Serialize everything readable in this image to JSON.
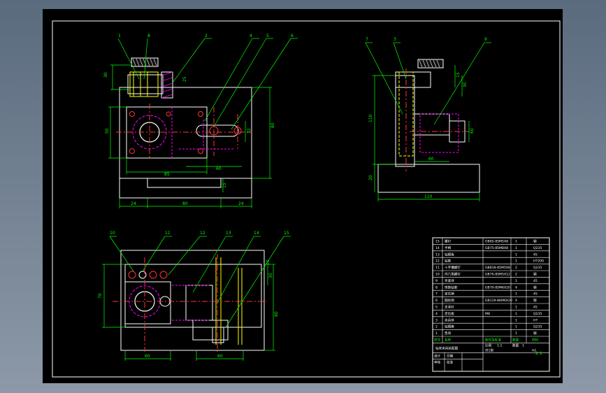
{
  "drawing": {
    "scale_note": "2:1",
    "front_view": {
      "balloons": [
        "1",
        "8",
        "2",
        "4",
        "5",
        "6"
      ],
      "dims": {
        "h_left_top": "30",
        "v_mid": "25",
        "left_height": "50",
        "hole_dia": "32",
        "right_height": "80",
        "width_85": "85",
        "width_60": "60",
        "bottom_24a": "24",
        "bottom_80": "80",
        "bottom_24b": "24",
        "step_15": "15"
      }
    },
    "side_view": {
      "balloons": [
        "7",
        "3",
        "9"
      ],
      "dims": {
        "height_110": "110",
        "base_20": "20",
        "top_15": "15",
        "side_30": "30",
        "pin_60": "60",
        "len_60": "60",
        "bottom_110": "110"
      }
    },
    "top_view": {
      "balloons": [
        "10",
        "11",
        "12",
        "13",
        "14",
        "15"
      ],
      "dims": {
        "height_70": "70",
        "bottom_60a": "60",
        "bottom_60b": "60",
        "right_80": "80",
        "right_30": "30",
        "right_20": "20"
      }
    },
    "bom": {
      "rows": [
        [
          "15",
          "螺钉",
          "GB65-85M5X8",
          "1",
          "钢"
        ],
        [
          "14",
          "手柄",
          "GB75-85M8X8",
          "1",
          "Q235"
        ],
        [
          "13",
          "钻模板",
          "",
          "1",
          "45"
        ],
        [
          "12",
          "钻套",
          "",
          "1",
          "HT200"
        ],
        [
          "11",
          "十字槽螺钉",
          "GB818-85M5X8",
          "2",
          "Q235"
        ],
        [
          "10",
          "内六角螺钉",
          "GB70-85M5X12",
          "2",
          "钢"
        ],
        [
          "9",
          "夹紧块",
          "",
          "1",
          "45"
        ],
        [
          "8",
          "快换钻套",
          "GB70-85M6X20",
          "4",
          "钢"
        ],
        [
          "7",
          "定位销",
          "",
          "1",
          "45"
        ],
        [
          "6",
          "圆柱销",
          "GB119-86M6X20",
          "4",
          "钢"
        ],
        [
          "5",
          "支承钉",
          "",
          "1",
          "45"
        ],
        [
          "4",
          "定位板",
          "M8",
          "1",
          "Q235"
        ],
        [
          "3",
          "夹具体",
          "",
          "1",
          "HT"
        ],
        [
          "2",
          "钻模座",
          "",
          "1",
          "Q235"
        ],
        [
          "1",
          "垫块",
          "",
          "1",
          "钢"
        ]
      ],
      "header": [
        "序号",
        "名称",
        "图号及标准",
        "数量",
        "材料"
      ],
      "title_block": {
        "name": "钻床夹具装配图",
        "scale_label": "比例",
        "scale": "1:1",
        "quantity_label": "数量",
        "quantity": "1",
        "sheet": "共1张",
        "drawn": "设计",
        "checked": "审核",
        "approved": "批准",
        "date": "日期",
        "code": "A2"
      }
    }
  }
}
